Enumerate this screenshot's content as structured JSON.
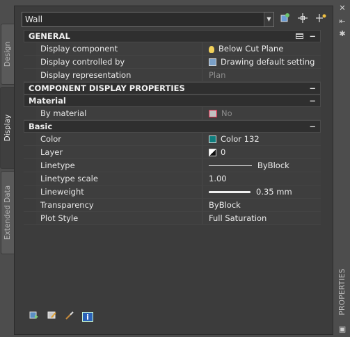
{
  "side_tabs": [
    {
      "label": "Design"
    },
    {
      "label": "Display"
    },
    {
      "label": "Extended Data"
    }
  ],
  "toolbar": {
    "object_type": "Wall"
  },
  "sections": {
    "general": {
      "title": "GENERAL",
      "rows": [
        {
          "name": "Display component",
          "value": "Below Cut Plane",
          "icon": "lightbulb-icon"
        },
        {
          "name": "Display controlled by",
          "value": "Drawing default setting",
          "icon": "display-control-icon"
        },
        {
          "name": "Display representation",
          "value": "Plan"
        }
      ]
    },
    "component_display": {
      "title": "COMPONENT DISPLAY PROPERTIES"
    },
    "material": {
      "title": "Material",
      "rows": [
        {
          "name": "By material",
          "value": "No",
          "icon": "material-icon"
        }
      ]
    },
    "basic": {
      "title": "Basic",
      "rows": [
        {
          "name": "Color",
          "value": "Color 132",
          "color_hex": "#0f7d7d"
        },
        {
          "name": "Layer",
          "value": "0"
        },
        {
          "name": "Linetype",
          "value": "ByBlock"
        },
        {
          "name": "Linetype scale",
          "value": "1.00"
        },
        {
          "name": "Lineweight",
          "value": "0.35 mm"
        },
        {
          "name": "Transparency",
          "value": "ByBlock"
        },
        {
          "name": "Plot Style",
          "value": "Full Saturation"
        }
      ]
    }
  },
  "collapse_glyph": "−",
  "palette_title": "PROPERTIES"
}
